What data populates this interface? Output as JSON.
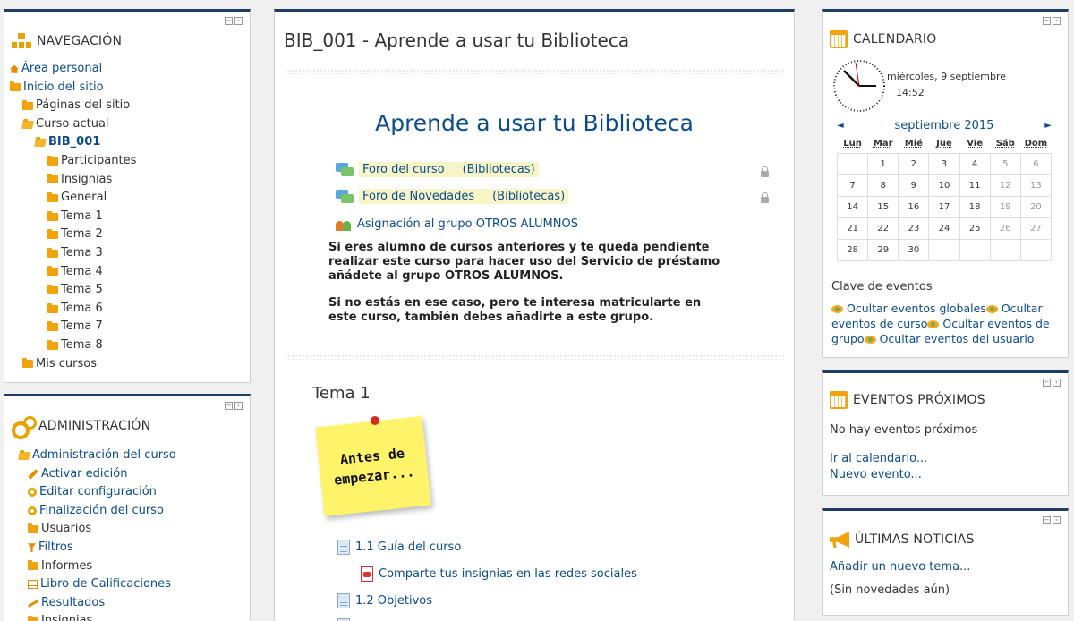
{
  "navigation": {
    "title": "NAVEGACIÓN",
    "items": [
      {
        "label": "Área personal",
        "level": 0,
        "icon": "home-icon"
      },
      {
        "label": "Inicio del sitio",
        "level": 0,
        "icon": "folder-icon"
      },
      {
        "label": "Páginas del sitio",
        "level": 1,
        "icon": "folder-icon"
      },
      {
        "label": "Curso actual",
        "level": 1,
        "icon": "folder-open-icon"
      },
      {
        "label": "BIB_001",
        "level": 2,
        "icon": "folder-open-icon"
      },
      {
        "label": "Participantes",
        "level": 3,
        "icon": "folder-icon"
      },
      {
        "label": "Insignias",
        "level": 3,
        "icon": "folder-icon"
      },
      {
        "label": "General",
        "level": 3,
        "icon": "folder-icon"
      },
      {
        "label": "Tema 1",
        "level": 3,
        "icon": "folder-icon"
      },
      {
        "label": "Tema 2",
        "level": 3,
        "icon": "folder-icon"
      },
      {
        "label": "Tema 3",
        "level": 3,
        "icon": "folder-icon"
      },
      {
        "label": "Tema 4",
        "level": 3,
        "icon": "folder-icon"
      },
      {
        "label": "Tema 5",
        "level": 3,
        "icon": "folder-icon"
      },
      {
        "label": "Tema 6",
        "level": 3,
        "icon": "folder-icon"
      },
      {
        "label": "Tema 7",
        "level": 3,
        "icon": "folder-icon"
      },
      {
        "label": "Tema 8",
        "level": 3,
        "icon": "folder-icon"
      },
      {
        "label": "Mis cursos",
        "level": 1,
        "icon": "folder-icon"
      }
    ]
  },
  "administration": {
    "title": "ADMINISTRACIÓN",
    "items": [
      {
        "label": "Administración del curso",
        "level": 0,
        "icon": "folder-open-icon"
      },
      {
        "label": "Activar edición",
        "level": 1,
        "icon": "pencil-icon"
      },
      {
        "label": "Editar configuración",
        "level": 1,
        "icon": "gear-icon"
      },
      {
        "label": "Finalización del curso",
        "level": 1,
        "icon": "gear-icon"
      },
      {
        "label": "Usuarios",
        "level": 1,
        "icon": "folder-icon"
      },
      {
        "label": "Filtros",
        "level": 1,
        "icon": "filter-icon"
      },
      {
        "label": "Informes",
        "level": 1,
        "icon": "folder-icon"
      },
      {
        "label": "Libro de Calificaciones",
        "level": 1,
        "icon": "grid-icon"
      },
      {
        "label": "Resultados",
        "level": 1,
        "icon": "wand-icon"
      },
      {
        "label": "Insignias",
        "level": 1,
        "icon": "folder-icon"
      }
    ]
  },
  "main": {
    "title": "BIB_001 - Aprende a usar tu Biblioteca",
    "course_heading": "Aprende a usar tu Biblioteca",
    "forum1": {
      "label": "Foro del curso",
      "group": "(Bibliotecas)"
    },
    "forum2": {
      "label": "Foro de Novedades",
      "group": "(Bibliotecas)"
    },
    "group_assign": "Asignación al grupo OTROS ALUMNOS",
    "para1": "Si eres alumno de cursos anteriores y te queda pendiente realizar este curso para hacer uso del Servicio de préstamo añádete al grupo OTROS ALUMNOS.",
    "para2": "Si no estás en ese caso, pero te interesa matricularte en este curso, también debes añadirte a este grupo.",
    "topic1": "Tema 1",
    "sticky_line1": "Antes de",
    "sticky_line2": "empezar...",
    "resource1": "1.1 Guía del curso",
    "resource2": "Comparte tus insignias en las redes sociales",
    "resource3": "1.2 Objetivos"
  },
  "calendar": {
    "title": "CALENDARIO",
    "date_line": "miércoles, 9 septiembre",
    "time": "14:52",
    "month": "septiembre 2015",
    "prev": "◄",
    "next": "►",
    "weekdays": [
      "Lun",
      "Mar",
      "Mié",
      "Jue",
      "Vie",
      "Sáb",
      "Dom"
    ],
    "weeks": [
      [
        "",
        "1",
        "2",
        "3",
        "4",
        "5",
        "6"
      ],
      [
        "7",
        "8",
        "9",
        "10",
        "11",
        "12",
        "13"
      ],
      [
        "14",
        "15",
        "16",
        "17",
        "18",
        "19",
        "20"
      ],
      [
        "21",
        "22",
        "23",
        "24",
        "25",
        "26",
        "27"
      ],
      [
        "28",
        "29",
        "30",
        "",
        "",
        "",
        ""
      ]
    ],
    "key_title": "Clave de eventos",
    "key1": "Ocultar eventos globales",
    "key2": "Ocultar eventos de curso",
    "key3": "Ocultar eventos de grupo",
    "key4": "Ocultar eventos del usuario"
  },
  "upcoming": {
    "title": "EVENTOS PRÓXIMOS",
    "empty": "No hay eventos próximos",
    "go_calendar": "Ir al calendario...",
    "new_event": "Nuevo evento..."
  },
  "news": {
    "title": "ÚLTIMAS NOTICIAS",
    "add_topic": "Añadir un nuevo tema...",
    "empty": "(Sin novedades aún)"
  },
  "colors": {
    "accent": "#1f3c63",
    "link": "#0b4c8c",
    "icon": "#f0a30a"
  }
}
